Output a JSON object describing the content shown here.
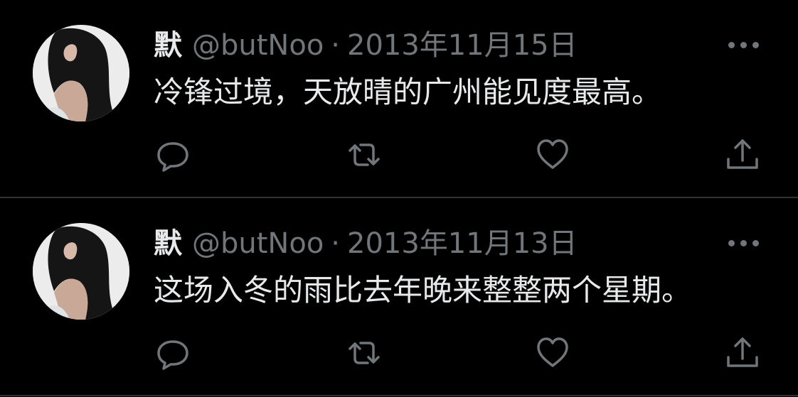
{
  "colors": {
    "background": "#000000",
    "primary_text": "#e7e9ea",
    "secondary_text": "#71767b",
    "divider": "#2f3336"
  },
  "tweets": [
    {
      "display_name": "默",
      "handle": "@butNoo",
      "separator": "·",
      "date": "2013年11月15日",
      "text": "冷锋过境，天放晴的广州能见度最高。",
      "avatar_icon": "profile-photo",
      "more_icon": "more-horizontal-icon",
      "actions": [
        "reply-icon",
        "retweet-icon",
        "like-icon",
        "share-icon"
      ]
    },
    {
      "display_name": "默",
      "handle": "@butNoo",
      "separator": "·",
      "date": "2013年11月13日",
      "text": "这场入冬的雨比去年晚来整整两个星期。",
      "avatar_icon": "profile-photo",
      "more_icon": "more-horizontal-icon",
      "actions": [
        "reply-icon",
        "retweet-icon",
        "like-icon",
        "share-icon"
      ]
    }
  ]
}
